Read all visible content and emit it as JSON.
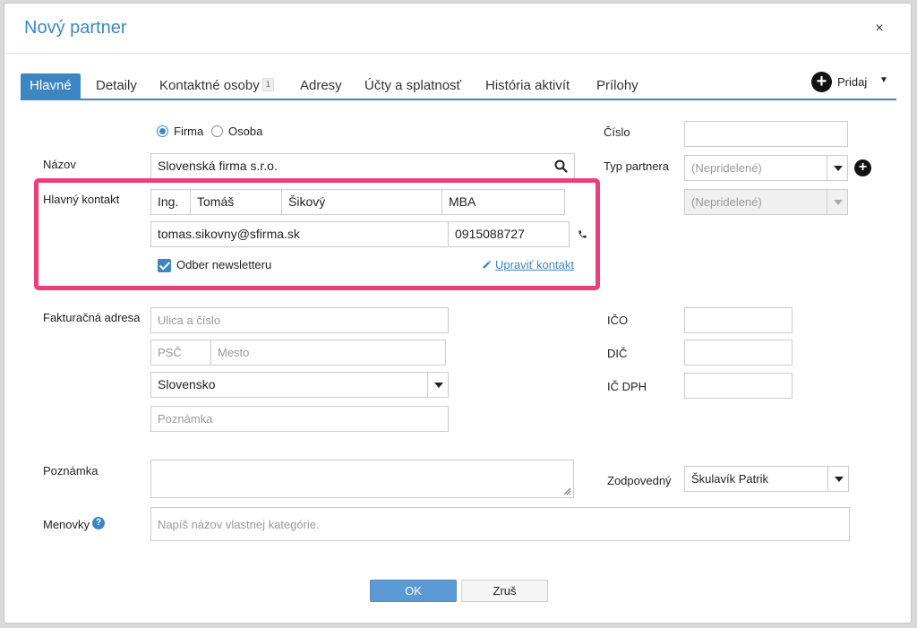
{
  "dialog": {
    "title": "Nový partner",
    "close": "×"
  },
  "tabs": [
    {
      "label": "Hlavné",
      "active": true
    },
    {
      "label": "Detaily"
    },
    {
      "label": "Kontaktné osoby",
      "badge": "1"
    },
    {
      "label": "Adresy"
    },
    {
      "label": "Účty a splatnosť"
    },
    {
      "label": "História aktivít"
    },
    {
      "label": "Prílohy"
    }
  ],
  "pridaj": {
    "label": "Pridaj",
    "icon": "plus-circle-icon"
  },
  "type_radio": {
    "firma": "Firma",
    "osoba": "Osoba",
    "selected": "Firma"
  },
  "nazov": {
    "label": "Názov",
    "value": "Slovenská firma s.r.o."
  },
  "hlavny_kontakt": {
    "label": "Hlavný kontakt",
    "title_before": "Ing.",
    "first_name": "Tomáš",
    "last_name": "Šikový",
    "title_after": "MBA",
    "email": "tomas.sikovny@sfirma.sk",
    "phone": "0915088727",
    "newsletter": "Odber newsletteru",
    "newsletter_checked": true,
    "edit_link": "Upraviť kontakt"
  },
  "fakturacna": {
    "label": "Fakturačná adresa",
    "street_placeholder": "Ulica a číslo",
    "psc_placeholder": "PSČ",
    "city_placeholder": "Mesto",
    "country": "Slovensko",
    "note_placeholder": "Poznámka"
  },
  "poznamka": {
    "label": "Poznámka"
  },
  "menovky": {
    "label": "Menovky",
    "placeholder": "Napíš názov vlastnej kategórie."
  },
  "right": {
    "cislo_label": "Číslo",
    "typ_partnera_label": "Typ partnera",
    "typ_partnera_value": "(Nepridelené)",
    "typ_partnera_sub_value": "(Nepridelené)",
    "ico_label": "IČO",
    "dic_label": "DIČ",
    "ic_dph_label": "IČ DPH",
    "zodpovedny_label": "Zodpovedný",
    "zodpovedny_value": "Škulavík Patrik"
  },
  "buttons": {
    "ok": "OK",
    "cancel": "Zruš"
  },
  "colors": {
    "accent": "#3e86c1",
    "highlight": "#ee3e7a"
  }
}
